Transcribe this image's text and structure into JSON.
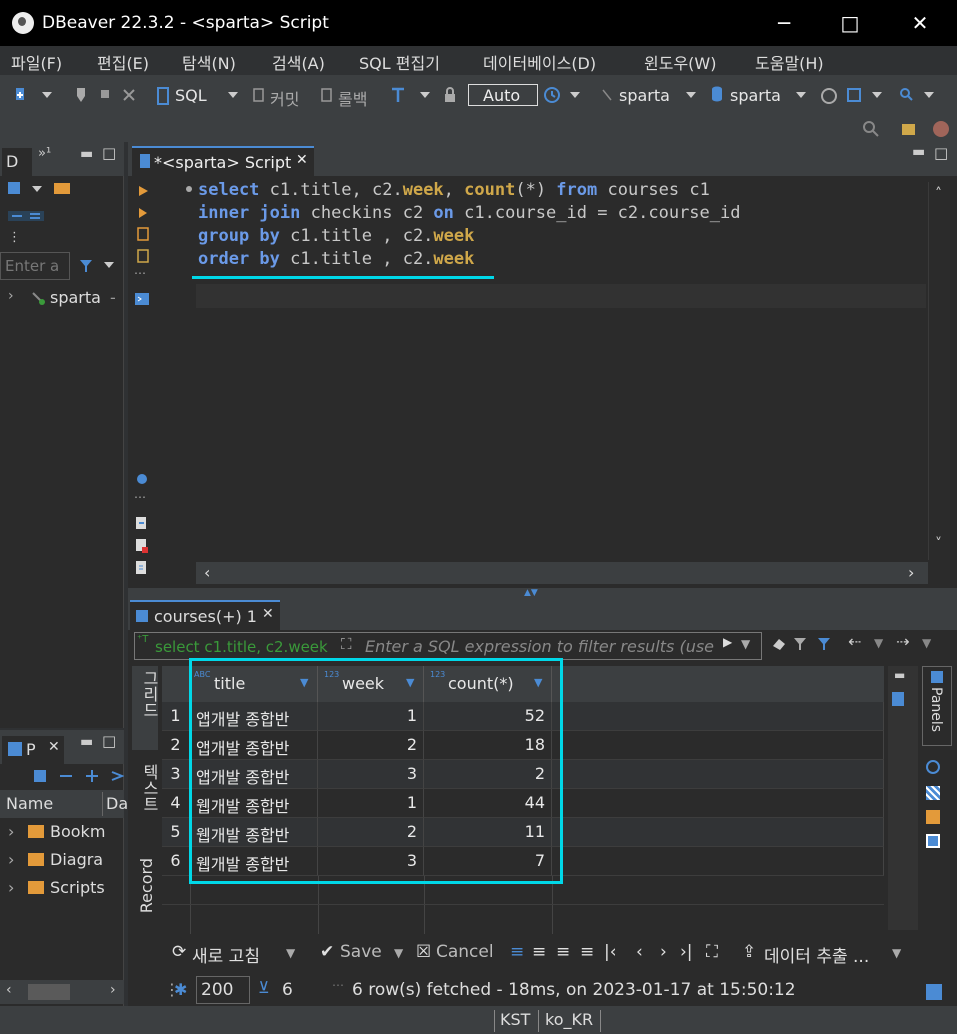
{
  "window": {
    "title": "DBeaver 22.3.2 - <sparta> Script"
  },
  "menu": [
    "파일(F)",
    "편집(E)",
    "탐색(N)",
    "검색(A)",
    "SQL 편집기",
    "데이터베이스(D)",
    "윈도우(W)",
    "도움말(H)"
  ],
  "toolbar": {
    "sql_label": "SQL",
    "commit_label": "커밋",
    "rollback_label": "롤백",
    "auto_label": "Auto",
    "datasource_label": "sparta",
    "schema_label": "sparta"
  },
  "navigator": {
    "tab_label": "D",
    "filter_placeholder": "Enter a",
    "tree_item": "sparta",
    "tree_item_suffix": "-"
  },
  "projects": {
    "tab_label": "P",
    "column_name": "Name",
    "column_da": "Da",
    "items": [
      "Bookm",
      "Diagra",
      "Scripts"
    ]
  },
  "editor": {
    "tab_label": "*<sparta> Script",
    "lines": [
      [
        {
          "t": "select",
          "c": "kw"
        },
        {
          "t": " c1.title, c2.",
          "c": "id"
        },
        {
          "t": "week",
          "c": "kw2"
        },
        {
          "t": ", ",
          "c": "id"
        },
        {
          "t": "count",
          "c": "kw2"
        },
        {
          "t": "(*) ",
          "c": "id"
        },
        {
          "t": "from",
          "c": "kw"
        },
        {
          "t": " courses c1",
          "c": "id"
        }
      ],
      [
        {
          "t": "inner join",
          "c": "kw"
        },
        {
          "t": " checkins c2 ",
          "c": "id"
        },
        {
          "t": "on",
          "c": "kw"
        },
        {
          "t": " c1.course_id = c2.course_id",
          "c": "id"
        }
      ],
      [
        {
          "t": "group by",
          "c": "kw"
        },
        {
          "t": " c1.title , c2.",
          "c": "id"
        },
        {
          "t": "week",
          "c": "kw2"
        }
      ],
      [
        {
          "t": "order by",
          "c": "kw"
        },
        {
          "t": " c1.title , c2.",
          "c": "id"
        },
        {
          "t": "week",
          "c": "kw2"
        }
      ]
    ]
  },
  "results": {
    "tab_label": "courses(+) 1",
    "filter_query": "select c1.title, c2.week",
    "filter_placeholder": "Enter a SQL expression to filter results (use",
    "side_tabs": [
      "그리드",
      "텍스트",
      "Record"
    ],
    "panels_label": "Panels",
    "columns": [
      {
        "label": "title",
        "type_badge": "ABC"
      },
      {
        "label": "week",
        "type_badge": "123"
      },
      {
        "label": "count(*)",
        "type_badge": "123"
      }
    ],
    "rows": [
      {
        "n": "1",
        "title": "앱개발 종합반",
        "week": "1",
        "count": "52"
      },
      {
        "n": "2",
        "title": "앱개발 종합반",
        "week": "2",
        "count": "18"
      },
      {
        "n": "3",
        "title": "앱개발 종합반",
        "week": "3",
        "count": "2"
      },
      {
        "n": "4",
        "title": "웹개발 종합반",
        "week": "1",
        "count": "44"
      },
      {
        "n": "5",
        "title": "웹개발 종합반",
        "week": "2",
        "count": "11"
      },
      {
        "n": "6",
        "title": "웹개발 종합반",
        "week": "3",
        "count": "7"
      }
    ],
    "refresh_label": "새로 고침",
    "save_label": "Save",
    "cancel_label": "Cancel",
    "export_label": "데이터 추출 ...",
    "fetch_size": "200",
    "row_count": "6",
    "status": "6 row(s) fetched - 18ms, on 2023-01-17 at 15:50:12"
  },
  "statusbar": {
    "tz": "KST",
    "locale": "ko_KR"
  },
  "colors": {
    "highlight": "#00d8e8",
    "keyword": "#6b9ae8",
    "function": "#d0a84a",
    "accent": "#4b8bd4"
  }
}
